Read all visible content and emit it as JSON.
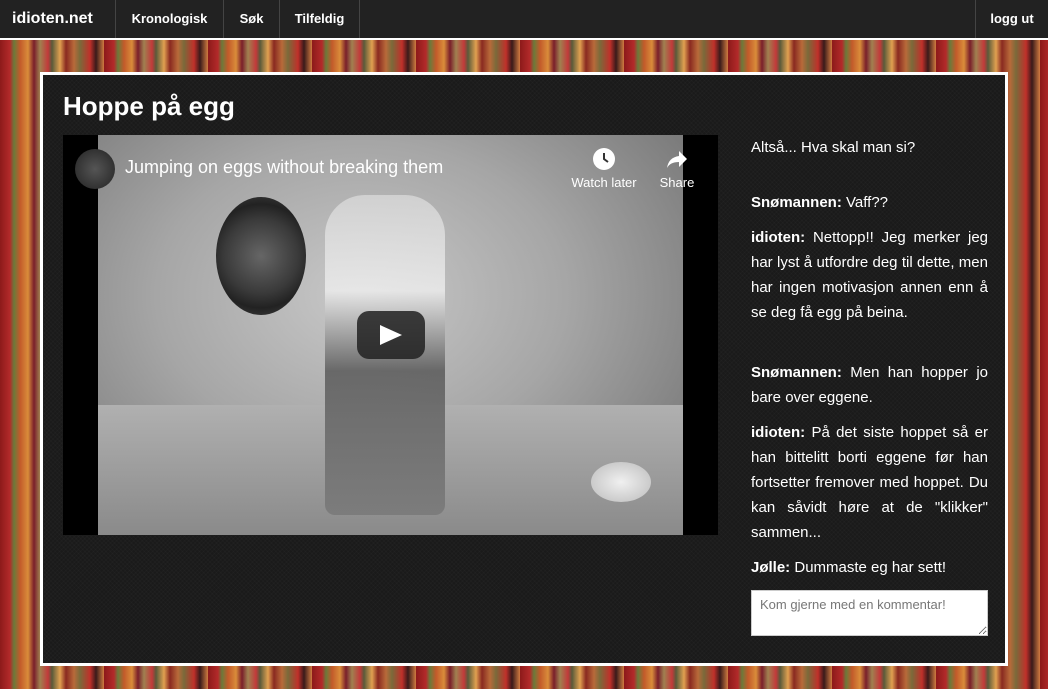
{
  "nav": {
    "brand": "idioten.net",
    "items": [
      "Kronologisk",
      "Søk",
      "Tilfeldig"
    ],
    "logout": "logg ut"
  },
  "post": {
    "title": "Hoppe på egg",
    "intro": "Altså... Hva skal man si?"
  },
  "video": {
    "title": "Jumping on eggs without breaking them",
    "watch_later": "Watch later",
    "share": "Share"
  },
  "comments": [
    {
      "author": "Snømannen:",
      "text": "Vaff??"
    },
    {
      "author": "idioten:",
      "text": "Nettopp!! Jeg merker jeg har lyst å utfordre deg til dette, men har ingen motivasjon annen enn å se deg få egg på beina."
    },
    {
      "author": "Snømannen:",
      "text": "Men han hopper jo bare over eggene."
    },
    {
      "author": "idioten:",
      "text": "På det siste hoppet så er han bittelitt borti eggene før han fortsetter fremover med hoppet. Du kan såvidt høre at de \"klikker\" sammen..."
    },
    {
      "author": "Jølle:",
      "text": "Dummaste eg har sett!"
    }
  ],
  "comment_input": {
    "placeholder": "Kom gjerne med en kommentar!",
    "value": ""
  }
}
